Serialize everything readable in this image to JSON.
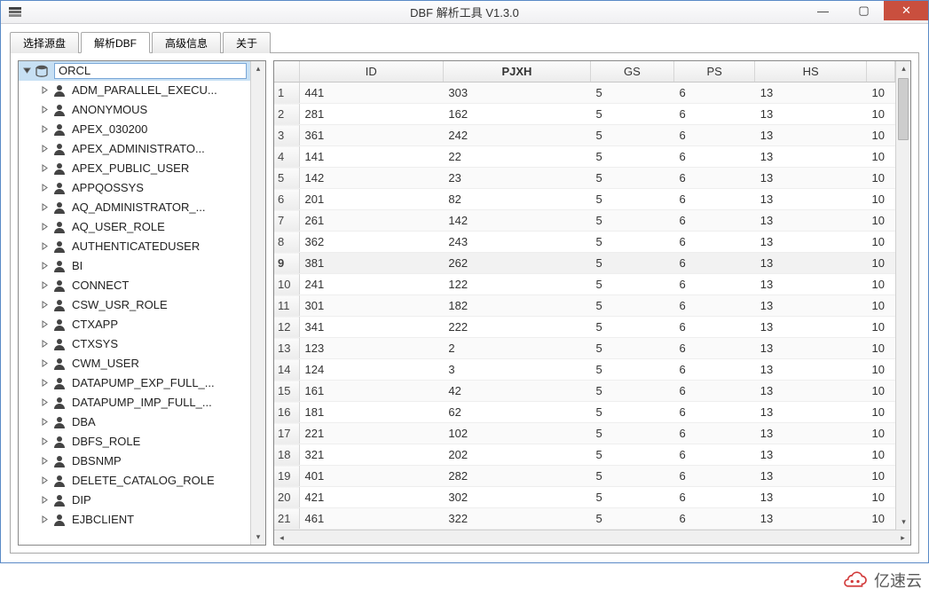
{
  "window": {
    "title": "DBF 解析工具  V1.3.0"
  },
  "tabs": [
    {
      "label": "选择源盘",
      "active": false
    },
    {
      "label": "解析DBF",
      "active": true
    },
    {
      "label": "高级信息",
      "active": false
    },
    {
      "label": "关于",
      "active": false
    }
  ],
  "tree": {
    "root": "ORCL",
    "items": [
      "ADM_PARALLEL_EXECU...",
      "ANONYMOUS",
      "APEX_030200",
      "APEX_ADMINISTRATO...",
      "APEX_PUBLIC_USER",
      "APPQOSSYS",
      "AQ_ADMINISTRATOR_...",
      "AQ_USER_ROLE",
      "AUTHENTICATEDUSER",
      "BI",
      "CONNECT",
      "CSW_USR_ROLE",
      "CTXAPP",
      "CTXSYS",
      "CWM_USER",
      "DATAPUMP_EXP_FULL_...",
      "DATAPUMP_IMP_FULL_...",
      "DBA",
      "DBFS_ROLE",
      "DBSNMP",
      "DELETE_CATALOG_ROLE",
      "DIP",
      "EJBCLIENT"
    ]
  },
  "grid": {
    "columns": [
      "ID",
      "PJXH",
      "GS",
      "PS",
      "HS",
      ""
    ],
    "sorted_col": "PJXH",
    "selected_row": 9,
    "rows": [
      {
        "n": 1,
        "ID": "441",
        "PJXH": "303",
        "GS": "5",
        "PS": "6",
        "HS": "13",
        "c6": "10"
      },
      {
        "n": 2,
        "ID": "281",
        "PJXH": "162",
        "GS": "5",
        "PS": "6",
        "HS": "13",
        "c6": "10"
      },
      {
        "n": 3,
        "ID": "361",
        "PJXH": "242",
        "GS": "5",
        "PS": "6",
        "HS": "13",
        "c6": "10"
      },
      {
        "n": 4,
        "ID": "141",
        "PJXH": "22",
        "GS": "5",
        "PS": "6",
        "HS": "13",
        "c6": "10"
      },
      {
        "n": 5,
        "ID": "142",
        "PJXH": "23",
        "GS": "5",
        "PS": "6",
        "HS": "13",
        "c6": "10"
      },
      {
        "n": 6,
        "ID": "201",
        "PJXH": "82",
        "GS": "5",
        "PS": "6",
        "HS": "13",
        "c6": "10"
      },
      {
        "n": 7,
        "ID": "261",
        "PJXH": "142",
        "GS": "5",
        "PS": "6",
        "HS": "13",
        "c6": "10"
      },
      {
        "n": 8,
        "ID": "362",
        "PJXH": "243",
        "GS": "5",
        "PS": "6",
        "HS": "13",
        "c6": "10"
      },
      {
        "n": 9,
        "ID": "381",
        "PJXH": "262",
        "GS": "5",
        "PS": "6",
        "HS": "13",
        "c6": "10"
      },
      {
        "n": 10,
        "ID": "241",
        "PJXH": "122",
        "GS": "5",
        "PS": "6",
        "HS": "13",
        "c6": "10"
      },
      {
        "n": 11,
        "ID": "301",
        "PJXH": "182",
        "GS": "5",
        "PS": "6",
        "HS": "13",
        "c6": "10"
      },
      {
        "n": 12,
        "ID": "341",
        "PJXH": "222",
        "GS": "5",
        "PS": "6",
        "HS": "13",
        "c6": "10"
      },
      {
        "n": 13,
        "ID": "123",
        "PJXH": "2",
        "GS": "5",
        "PS": "6",
        "HS": "13",
        "c6": "10"
      },
      {
        "n": 14,
        "ID": "124",
        "PJXH": "3",
        "GS": "5",
        "PS": "6",
        "HS": "13",
        "c6": "10"
      },
      {
        "n": 15,
        "ID": "161",
        "PJXH": "42",
        "GS": "5",
        "PS": "6",
        "HS": "13",
        "c6": "10"
      },
      {
        "n": 16,
        "ID": "181",
        "PJXH": "62",
        "GS": "5",
        "PS": "6",
        "HS": "13",
        "c6": "10"
      },
      {
        "n": 17,
        "ID": "221",
        "PJXH": "102",
        "GS": "5",
        "PS": "6",
        "HS": "13",
        "c6": "10"
      },
      {
        "n": 18,
        "ID": "321",
        "PJXH": "202",
        "GS": "5",
        "PS": "6",
        "HS": "13",
        "c6": "10"
      },
      {
        "n": 19,
        "ID": "401",
        "PJXH": "282",
        "GS": "5",
        "PS": "6",
        "HS": "13",
        "c6": "10"
      },
      {
        "n": 20,
        "ID": "421",
        "PJXH": "302",
        "GS": "5",
        "PS": "6",
        "HS": "13",
        "c6": "10"
      },
      {
        "n": 21,
        "ID": "461",
        "PJXH": "322",
        "GS": "5",
        "PS": "6",
        "HS": "13",
        "c6": "10"
      }
    ]
  },
  "watermark": "亿速云"
}
